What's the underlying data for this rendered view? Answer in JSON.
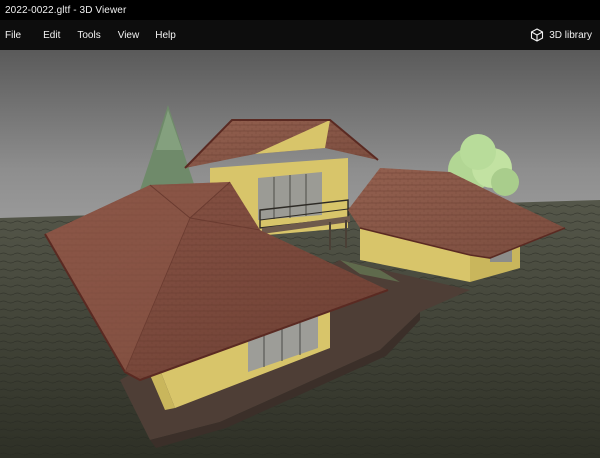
{
  "window": {
    "title": "2022-0022.gltf - 3D Viewer"
  },
  "menu": {
    "items": [
      "File",
      "Edit",
      "Tools",
      "View",
      "Help"
    ],
    "library_label": "3D library"
  },
  "colors": {
    "sky_top": "#5c5c5c",
    "sky_horizon": "#9a9a9a",
    "ground": "#3a3c30",
    "roof": "#7a4a3a",
    "wall": "#d8c56a",
    "tree_dark": "#6f8a6a",
    "tree_light": "#b8dc9a"
  }
}
